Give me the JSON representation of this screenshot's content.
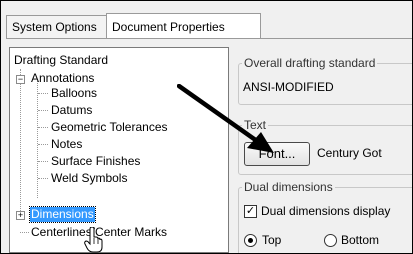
{
  "tabs": [
    {
      "label": "System Options",
      "active": false
    },
    {
      "label": "Document Properties",
      "active": true
    }
  ],
  "tree": {
    "root_label": "Drafting Standard",
    "annotations": {
      "label": "Annotations",
      "expander": "−",
      "children": [
        "Balloons",
        "Datums",
        "Geometric Tolerances",
        "Notes",
        "Surface Finishes",
        "Weld Symbols"
      ]
    },
    "dimensions": {
      "label": "Dimensions",
      "expander": "+"
    },
    "centerlines": {
      "label": "Centerlines/Center Marks"
    }
  },
  "overall_standard": {
    "group_label": "Overall drafting standard",
    "value": "ANSI-MODIFIED"
  },
  "text_group": {
    "group_label": "Text",
    "font_button": "Font...",
    "font_value": "Century Got"
  },
  "dual_dimensions": {
    "group_label": "Dual dimensions",
    "display_label": "Dual dimensions display",
    "display_checked": true,
    "top_label": "Top",
    "bottom_label": "Bottom",
    "selected": "Top"
  },
  "colors": {
    "selection": "#3399ff",
    "annotation_arrow": "#000000"
  }
}
